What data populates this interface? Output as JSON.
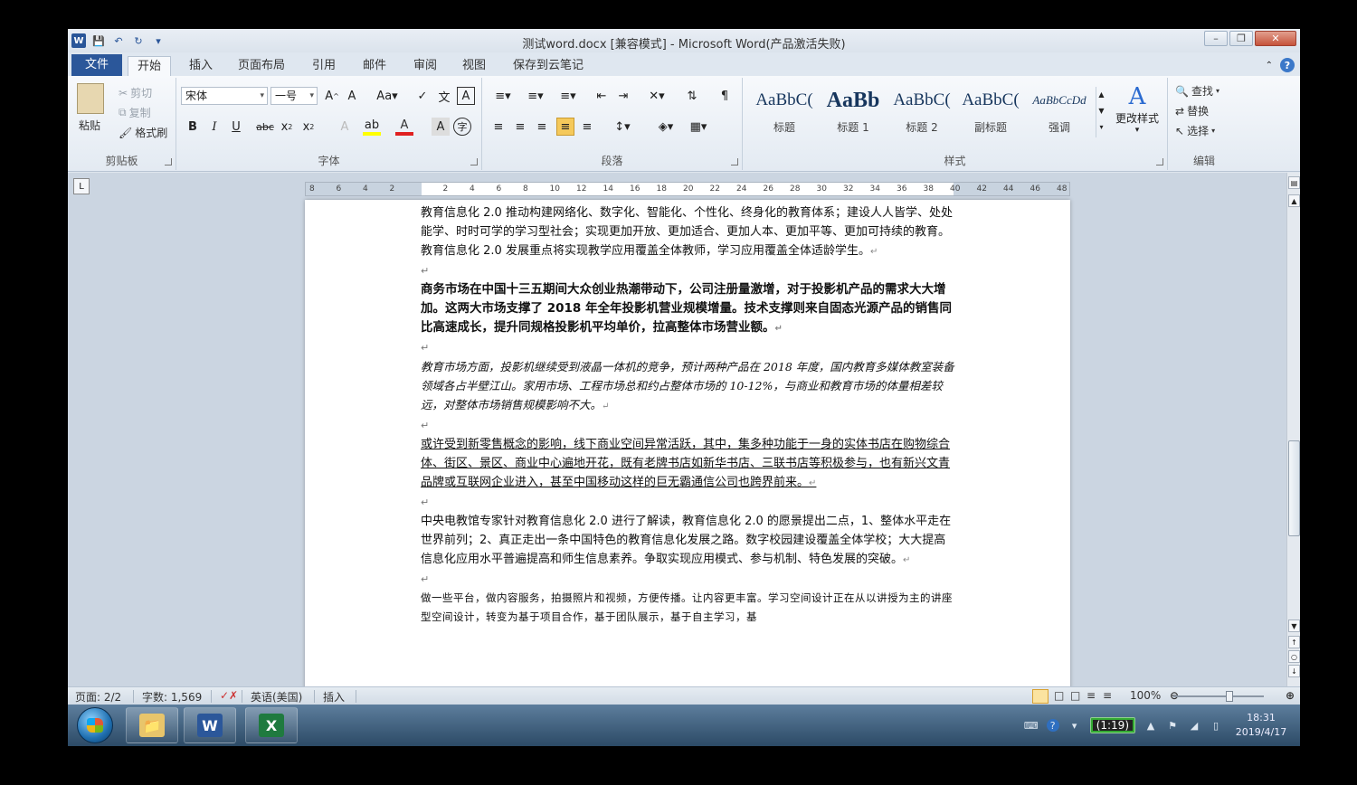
{
  "window": {
    "title": "测试word.docx [兼容模式]  -  Microsoft Word(产品激活失败)"
  },
  "qat": {
    "save_icon": "save-icon",
    "undo_icon": "undo-icon",
    "redo_icon": "redo-icon"
  },
  "tabs": [
    {
      "label": "文件"
    },
    {
      "label": "开始"
    },
    {
      "label": "插入"
    },
    {
      "label": "页面布局"
    },
    {
      "label": "引用"
    },
    {
      "label": "邮件"
    },
    {
      "label": "审阅"
    },
    {
      "label": "视图"
    },
    {
      "label": "保存到云笔记"
    }
  ],
  "ribbon": {
    "clipboard": {
      "paste": "粘贴",
      "cut": "剪切",
      "copy": "复制",
      "format_painter": "格式刷",
      "label": "剪贴板"
    },
    "font": {
      "name": "宋体",
      "size": "一号",
      "label": "字体"
    },
    "paragraph": {
      "label": "段落"
    },
    "styles": {
      "label": "样式",
      "items": [
        {
          "sample": "AaBbC(",
          "name": "标题"
        },
        {
          "sample": "AaBb",
          "name": "标题 1"
        },
        {
          "sample": "AaBbC(",
          "name": "标题 2"
        },
        {
          "sample": "AaBbC(",
          "name": "副标题"
        },
        {
          "sample": "AaBbCcDd",
          "name": "强调"
        }
      ],
      "change": "更改样式"
    },
    "editing": {
      "find": "查找",
      "replace": "替换",
      "select": "选择",
      "label": "编辑"
    }
  },
  "ruler": {
    "ticks": [
      "8",
      "6",
      "4",
      "2",
      "",
      "2",
      "4",
      "6",
      "8",
      "10",
      "12",
      "14",
      "16",
      "18",
      "20",
      "22",
      "24",
      "26",
      "28",
      "30",
      "32",
      "34",
      "36",
      "38",
      "40",
      "42",
      "44",
      "46",
      "48"
    ]
  },
  "document": {
    "p1": "教育信息化 2.0 推动构建网络化、数字化、智能化、个性化、终身化的教育体系；建设人人皆学、处处能学、时时可学的学习型社会；实现更加开放、更加适合、更加人本、更加平等、更加可持续的教育。教育信息化 2.0 发展重点将实现教学应用覆盖全体教师，学习应用覆盖全体适龄学生。",
    "p2": "商务市场在中国十三五期间大众创业热潮带动下，公司注册量激增，对于投影机产品的需求大大增加。这两大市场支撑了 2018 年全年投影机营业规模增量。技术支撑则来自固态光源产品的销售同比高速成长，提升同规格投影机平均单价，拉高整体市场营业额。",
    "p3": "教育市场方面，投影机继续受到液晶一体机的竞争，预计两种产品在 2018 年度，国内教育多媒体教室装备领域各占半壁江山。家用市场、工程市场总和约占整体市场的 10-12%，与商业和教育市场的体量相差较远，对整体市场销售规模影响不大。",
    "p4": "或许受到新零售概念的影响，线下商业空间异常活跃，其中，集多种功能于一身的实体书店在购物综合体、街区、景区、商业中心遍地开花，既有老牌书店如新华书店、三联书店等积极参与，也有新兴文青品牌或互联网企业进入，甚至中国移动这样的巨无霸通信公司也跨界前来。",
    "p5": "中央电教馆专家针对教育信息化 2.0 进行了解读，教育信息化 2.0 的愿景提出二点，1、整体水平走在世界前列；2、真正走出一条中国特色的教育信息化发展之路。数字校园建设覆盖全体学校；大大提高信息化应用水平普遍提高和师生信息素养。争取实现应用模式、参与机制、特色发展的突破。",
    "p6": "做一些平台，做内容服务，拍摄照片和视频，方便传播。让内容更丰富。学习空间设计正在从以讲授为主的讲座型空间设计，转变为基于项目合作，基于团队展示，基于自主学习，基"
  },
  "status": {
    "page": "页面: 2/2",
    "words": "字数: 1,569",
    "language": "英语(美国)",
    "mode": "插入",
    "zoom": "100%"
  },
  "taskbar": {
    "battery": "(1:19)",
    "time": "18:31",
    "date": "2019/4/17"
  }
}
